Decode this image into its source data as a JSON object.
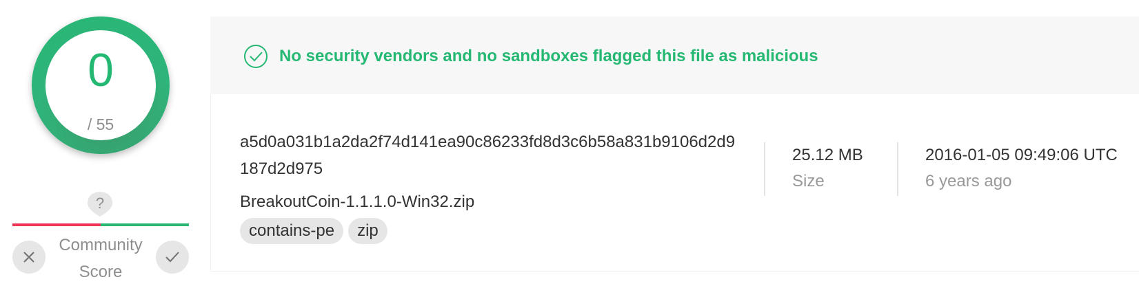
{
  "score": {
    "detections": "0",
    "total": "/ 55",
    "ring_color": "#25b873"
  },
  "community": {
    "marker_symbol": "?",
    "label": "Community Score",
    "down_icon": "close-icon",
    "up_icon": "check-icon",
    "negative_color": "#ef3458",
    "positive_color": "#25b873"
  },
  "banner": {
    "icon": "check-circle-icon",
    "message": "No security vendors and no sandboxes flagged this file as malicious",
    "color": "#25b873"
  },
  "file": {
    "hash": "a5d0a031b1a2da2f74d141ea90c86233fd8d3c6b58a831b9106d2d9187d2d975",
    "name": "BreakoutCoin-1.1.1.0-Win32.zip",
    "tags": [
      "contains-pe",
      "zip"
    ]
  },
  "stats": {
    "size_value": "25.12 MB",
    "size_label": "Size",
    "date_value": "2016-01-05 09:49:06 UTC",
    "date_label": "6 years ago"
  }
}
